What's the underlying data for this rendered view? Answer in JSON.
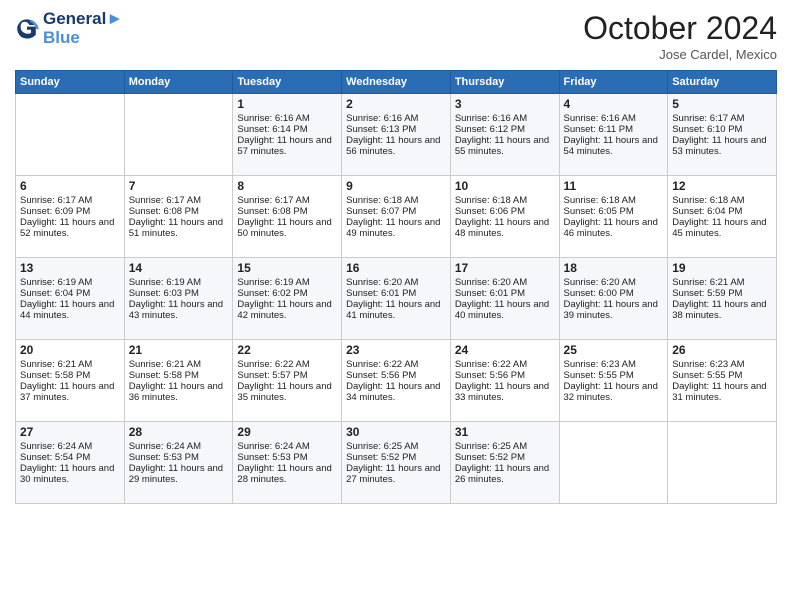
{
  "header": {
    "logo_line1": "General",
    "logo_line2": "Blue",
    "month": "October 2024",
    "location": "Jose Cardel, Mexico"
  },
  "days_of_week": [
    "Sunday",
    "Monday",
    "Tuesday",
    "Wednesday",
    "Thursday",
    "Friday",
    "Saturday"
  ],
  "weeks": [
    [
      {
        "day": "",
        "sunrise": "",
        "sunset": "",
        "daylight": ""
      },
      {
        "day": "",
        "sunrise": "",
        "sunset": "",
        "daylight": ""
      },
      {
        "day": "1",
        "sunrise": "Sunrise: 6:16 AM",
        "sunset": "Sunset: 6:14 PM",
        "daylight": "Daylight: 11 hours and 57 minutes."
      },
      {
        "day": "2",
        "sunrise": "Sunrise: 6:16 AM",
        "sunset": "Sunset: 6:13 PM",
        "daylight": "Daylight: 11 hours and 56 minutes."
      },
      {
        "day": "3",
        "sunrise": "Sunrise: 6:16 AM",
        "sunset": "Sunset: 6:12 PM",
        "daylight": "Daylight: 11 hours and 55 minutes."
      },
      {
        "day": "4",
        "sunrise": "Sunrise: 6:16 AM",
        "sunset": "Sunset: 6:11 PM",
        "daylight": "Daylight: 11 hours and 54 minutes."
      },
      {
        "day": "5",
        "sunrise": "Sunrise: 6:17 AM",
        "sunset": "Sunset: 6:10 PM",
        "daylight": "Daylight: 11 hours and 53 minutes."
      }
    ],
    [
      {
        "day": "6",
        "sunrise": "Sunrise: 6:17 AM",
        "sunset": "Sunset: 6:09 PM",
        "daylight": "Daylight: 11 hours and 52 minutes."
      },
      {
        "day": "7",
        "sunrise": "Sunrise: 6:17 AM",
        "sunset": "Sunset: 6:08 PM",
        "daylight": "Daylight: 11 hours and 51 minutes."
      },
      {
        "day": "8",
        "sunrise": "Sunrise: 6:17 AM",
        "sunset": "Sunset: 6:08 PM",
        "daylight": "Daylight: 11 hours and 50 minutes."
      },
      {
        "day": "9",
        "sunrise": "Sunrise: 6:18 AM",
        "sunset": "Sunset: 6:07 PM",
        "daylight": "Daylight: 11 hours and 49 minutes."
      },
      {
        "day": "10",
        "sunrise": "Sunrise: 6:18 AM",
        "sunset": "Sunset: 6:06 PM",
        "daylight": "Daylight: 11 hours and 48 minutes."
      },
      {
        "day": "11",
        "sunrise": "Sunrise: 6:18 AM",
        "sunset": "Sunset: 6:05 PM",
        "daylight": "Daylight: 11 hours and 46 minutes."
      },
      {
        "day": "12",
        "sunrise": "Sunrise: 6:18 AM",
        "sunset": "Sunset: 6:04 PM",
        "daylight": "Daylight: 11 hours and 45 minutes."
      }
    ],
    [
      {
        "day": "13",
        "sunrise": "Sunrise: 6:19 AM",
        "sunset": "Sunset: 6:04 PM",
        "daylight": "Daylight: 11 hours and 44 minutes."
      },
      {
        "day": "14",
        "sunrise": "Sunrise: 6:19 AM",
        "sunset": "Sunset: 6:03 PM",
        "daylight": "Daylight: 11 hours and 43 minutes."
      },
      {
        "day": "15",
        "sunrise": "Sunrise: 6:19 AM",
        "sunset": "Sunset: 6:02 PM",
        "daylight": "Daylight: 11 hours and 42 minutes."
      },
      {
        "day": "16",
        "sunrise": "Sunrise: 6:20 AM",
        "sunset": "Sunset: 6:01 PM",
        "daylight": "Daylight: 11 hours and 41 minutes."
      },
      {
        "day": "17",
        "sunrise": "Sunrise: 6:20 AM",
        "sunset": "Sunset: 6:01 PM",
        "daylight": "Daylight: 11 hours and 40 minutes."
      },
      {
        "day": "18",
        "sunrise": "Sunrise: 6:20 AM",
        "sunset": "Sunset: 6:00 PM",
        "daylight": "Daylight: 11 hours and 39 minutes."
      },
      {
        "day": "19",
        "sunrise": "Sunrise: 6:21 AM",
        "sunset": "Sunset: 5:59 PM",
        "daylight": "Daylight: 11 hours and 38 minutes."
      }
    ],
    [
      {
        "day": "20",
        "sunrise": "Sunrise: 6:21 AM",
        "sunset": "Sunset: 5:58 PM",
        "daylight": "Daylight: 11 hours and 37 minutes."
      },
      {
        "day": "21",
        "sunrise": "Sunrise: 6:21 AM",
        "sunset": "Sunset: 5:58 PM",
        "daylight": "Daylight: 11 hours and 36 minutes."
      },
      {
        "day": "22",
        "sunrise": "Sunrise: 6:22 AM",
        "sunset": "Sunset: 5:57 PM",
        "daylight": "Daylight: 11 hours and 35 minutes."
      },
      {
        "day": "23",
        "sunrise": "Sunrise: 6:22 AM",
        "sunset": "Sunset: 5:56 PM",
        "daylight": "Daylight: 11 hours and 34 minutes."
      },
      {
        "day": "24",
        "sunrise": "Sunrise: 6:22 AM",
        "sunset": "Sunset: 5:56 PM",
        "daylight": "Daylight: 11 hours and 33 minutes."
      },
      {
        "day": "25",
        "sunrise": "Sunrise: 6:23 AM",
        "sunset": "Sunset: 5:55 PM",
        "daylight": "Daylight: 11 hours and 32 minutes."
      },
      {
        "day": "26",
        "sunrise": "Sunrise: 6:23 AM",
        "sunset": "Sunset: 5:55 PM",
        "daylight": "Daylight: 11 hours and 31 minutes."
      }
    ],
    [
      {
        "day": "27",
        "sunrise": "Sunrise: 6:24 AM",
        "sunset": "Sunset: 5:54 PM",
        "daylight": "Daylight: 11 hours and 30 minutes."
      },
      {
        "day": "28",
        "sunrise": "Sunrise: 6:24 AM",
        "sunset": "Sunset: 5:53 PM",
        "daylight": "Daylight: 11 hours and 29 minutes."
      },
      {
        "day": "29",
        "sunrise": "Sunrise: 6:24 AM",
        "sunset": "Sunset: 5:53 PM",
        "daylight": "Daylight: 11 hours and 28 minutes."
      },
      {
        "day": "30",
        "sunrise": "Sunrise: 6:25 AM",
        "sunset": "Sunset: 5:52 PM",
        "daylight": "Daylight: 11 hours and 27 minutes."
      },
      {
        "day": "31",
        "sunrise": "Sunrise: 6:25 AM",
        "sunset": "Sunset: 5:52 PM",
        "daylight": "Daylight: 11 hours and 26 minutes."
      },
      {
        "day": "",
        "sunrise": "",
        "sunset": "",
        "daylight": ""
      },
      {
        "day": "",
        "sunrise": "",
        "sunset": "",
        "daylight": ""
      }
    ]
  ]
}
